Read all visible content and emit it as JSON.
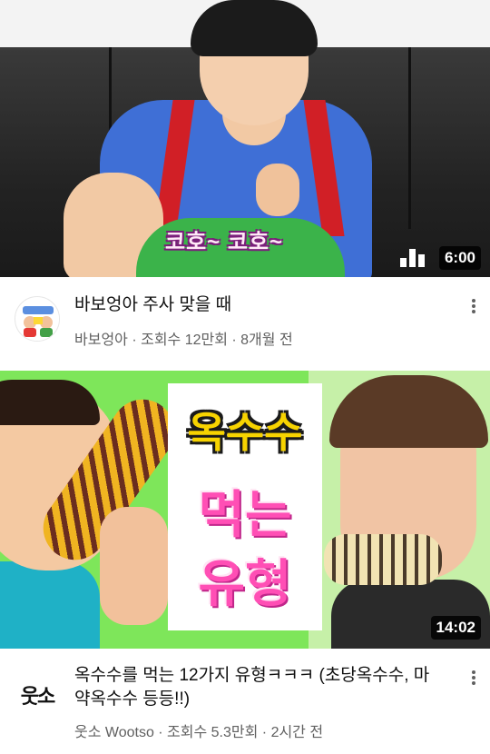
{
  "videos": [
    {
      "thumbnail_caption": "코호~ 코호~",
      "duration": "6:00",
      "title": "바보엉아 주사 맞을 때",
      "channel": "바보엉아",
      "stats": "바보엉아 · 조회수 12만회 · 8개월 전",
      "avatar_icon": "channel-avatar-babo"
    },
    {
      "thumbnail_text": [
        "옥수수",
        "먹는",
        "유형"
      ],
      "duration": "14:02",
      "title": "옥수수를 먹는 12가지 유형ㅋㅋㅋ (초당옥수수, 마약옥수수 등등!!)",
      "channel": "웃소 Wootso",
      "stats": "웃소 Wootso · 조회수 5.3만회 · 2시간 전",
      "avatar_text": "웃소"
    }
  ],
  "colors": {
    "title": "#0f0f0f",
    "secondary": "#606060",
    "badge_bg": "#000000"
  }
}
